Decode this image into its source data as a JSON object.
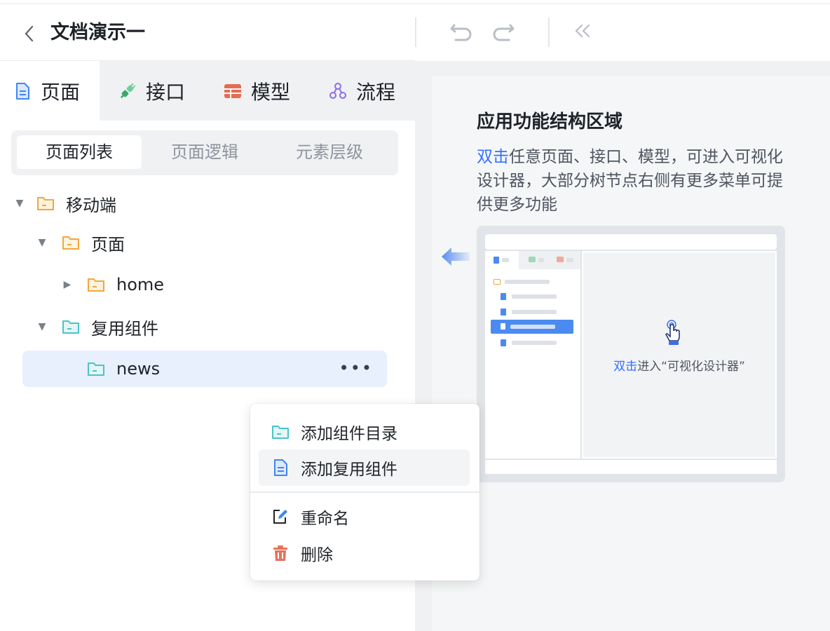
{
  "header": {
    "title": "文档演示一"
  },
  "toolbar": {
    "undo_icon": "undo-icon",
    "redo_icon": "redo-icon",
    "collapse_icon": "double-chevron-left-icon"
  },
  "tabs": [
    {
      "label": "页面",
      "icon": "page-icon",
      "active": true
    },
    {
      "label": "接口",
      "icon": "plug-icon",
      "active": false
    },
    {
      "label": "模型",
      "icon": "table-icon",
      "active": false
    },
    {
      "label": "流程",
      "icon": "flow-icon",
      "active": false
    }
  ],
  "segments": [
    {
      "label": "页面列表",
      "active": true
    },
    {
      "label": "页面逻辑",
      "active": false
    },
    {
      "label": "元素层级",
      "active": false
    }
  ],
  "tree": [
    {
      "label": "移动端",
      "expanded": true,
      "level": 0,
      "folder_color": "#f0a83a"
    },
    {
      "label": "页面",
      "expanded": true,
      "level": 1,
      "folder_color": "#f0a83a"
    },
    {
      "label": "home",
      "expanded": false,
      "level": 2,
      "folder_color": "#f0a83a"
    },
    {
      "label": "复用组件",
      "expanded": true,
      "level": 1,
      "folder_color": "#4cc3c9"
    },
    {
      "label": "news",
      "level": 2,
      "selected": true,
      "folder_color": "#4cc3c9",
      "more": "•••"
    }
  ],
  "context_menu": {
    "items": [
      {
        "label": "添加组件目录",
        "icon": "folder-icon"
      },
      {
        "label": "添加复用组件",
        "icon": "document-icon"
      },
      {
        "label": "重命名",
        "icon": "edit-icon"
      },
      {
        "label": "删除",
        "icon": "trash-icon"
      }
    ]
  },
  "guide": {
    "title": "应用功能结构区域",
    "desc_highlight": "双击",
    "desc_rest": "任意页面、接口、模型，可进入可视化设计器，大部分树节点右侧有更多菜单可提供更多功能",
    "preview_caption_highlight": "双击",
    "preview_caption_rest": "进入“可视化设计器”"
  },
  "colors": {
    "accent": "#3370ff",
    "folder_orange": "#f0a83a",
    "folder_teal": "#4cc3c9",
    "delete_red": "#e5735b"
  }
}
